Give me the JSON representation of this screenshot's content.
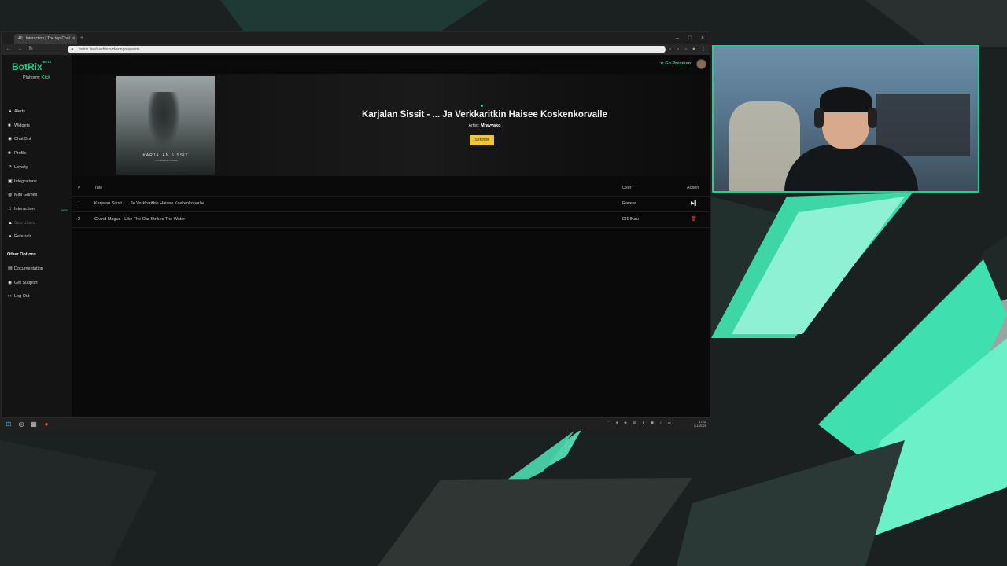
{
  "browser": {
    "tab_title": "40 | Interaction | The top Chat",
    "tab_close": "×",
    "new_tab": "+",
    "url": "botrix.live/dashboard/songrequests",
    "window_controls": [
      "–",
      "□",
      "×"
    ],
    "nav": [
      "←",
      "→",
      "↻"
    ]
  },
  "app": {
    "logo": "BotRix",
    "logo_badge": "BETA",
    "platform_label": "Platform:",
    "platform_value": "Kick",
    "go_premium": "Go Premium",
    "nav_items": [
      {
        "label": "Alerts",
        "icon": "bell-icon",
        "glyph": "▲"
      },
      {
        "label": "Widgets",
        "icon": "widgets-icon",
        "glyph": "■"
      },
      {
        "label": "Chat Bot",
        "icon": "chat-bot-icon",
        "glyph": "◉"
      },
      {
        "label": "Profile",
        "icon": "profile-icon",
        "glyph": "■"
      },
      {
        "label": "Loyalty",
        "icon": "loyalty-icon",
        "glyph": "↗"
      },
      {
        "label": "Integrations",
        "icon": "integrations-icon",
        "glyph": "▣"
      },
      {
        "label": "Mini Games",
        "icon": "mini-games-icon",
        "glyph": "◍"
      },
      {
        "label": "Interaction",
        "icon": "music-icon",
        "glyph": "♫",
        "badge": "NEW"
      },
      {
        "label": "Sub-Users",
        "icon": "sub-users-icon",
        "glyph": "▲",
        "disabled": true
      },
      {
        "label": "Referrals",
        "icon": "referrals-icon",
        "glyph": "▲"
      }
    ],
    "other_heading": "Other Options",
    "other_items": [
      {
        "label": "Documentation",
        "icon": "documentation-icon",
        "glyph": "▤"
      },
      {
        "label": "Get Support",
        "icon": "support-icon",
        "glyph": "◉"
      },
      {
        "label": "Log Out",
        "icon": "log-out-icon",
        "glyph": "↦"
      }
    ]
  },
  "now_playing": {
    "title": "Karjalan Sissit - ... Ja Verkkaritkin Haisee Koskenkorvalle",
    "artist_label": "Artist:",
    "artist": "Mravyako",
    "settings_button": "Settings",
    "cover_title": "KARJALAN SISSIT",
    "cover_subtitle": "... ja verkkaritkin haisee"
  },
  "queue": {
    "columns": [
      "#",
      "Title",
      "User",
      "Action"
    ],
    "rows": [
      {
        "num": "1",
        "title": "Karjalan Sissit - ... Ja Verkkaritkin Haisee Koskenkorvalle",
        "user": "Ravew",
        "action_icon": "play-icon",
        "action_glyph": "▶▌"
      },
      {
        "num": "2",
        "title": "Grand Magus - Like The Oar Strikes The Water",
        "user": "DIDIKau",
        "action_icon": "trash-icon",
        "action_glyph": "🗑"
      }
    ]
  },
  "taskbar": {
    "icons": [
      {
        "name": "windows-start-icon",
        "glyph": "⊞"
      },
      {
        "name": "obs-icon",
        "glyph": "◎"
      },
      {
        "name": "app-icon",
        "glyph": "▦"
      },
      {
        "name": "browser-icon",
        "glyph": "●"
      }
    ],
    "tray": "⌃ ● ◈ ▤ ◐ ◉ ♪ ☷",
    "time": "17:11",
    "date": "8.1.2025"
  },
  "colors": {
    "accent": "#1fd18a",
    "settings_button": "#f0c53a",
    "webcam_border": "#1fd18a"
  }
}
